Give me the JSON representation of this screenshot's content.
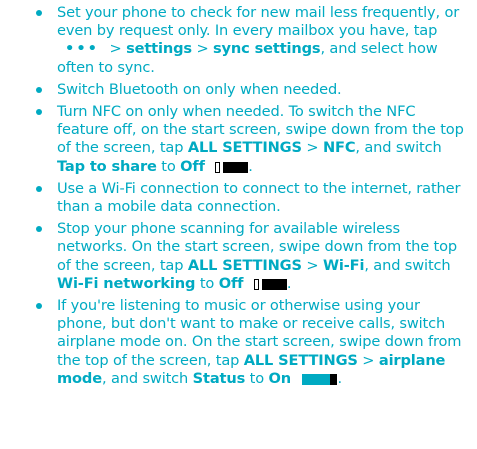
{
  "tips": {
    "t1": {
      "a": "Set your phone to check for new mail less frequently, or even by request only. In every mailbox you have, tap",
      "dots": "•••",
      "sep1": ">",
      "b1": "settings",
      "sep2": ">",
      "b2": "sync settings",
      "c": ", and select how often to sync."
    },
    "t2": {
      "a": "Switch Bluetooth on only when needed."
    },
    "t3": {
      "a": "Turn NFC on only when needed. To switch the NFC feature off, on the start screen, swipe down from the top of the screen, tap",
      "b1": "ALL SETTINGS",
      "sep1": ">",
      "b2": "NFC",
      "c": ", and switch",
      "b3": "Tap to share",
      "d": "to",
      "b4": "Off",
      "e": "."
    },
    "t4": {
      "a": "Use a Wi-Fi connection to connect to the internet, rather than a mobile data connection."
    },
    "t5": {
      "a": "Stop your phone scanning for available wireless networks. On the start screen, swipe down from the top of the screen, tap",
      "b1": "ALL SETTINGS",
      "sep1": ">",
      "b2": "Wi-Fi",
      "c": ", and switch",
      "b3": "Wi-Fi networking",
      "d": "to",
      "b4": "Off",
      "e": "."
    },
    "t6": {
      "a": "If you're listening to music or otherwise using your phone, but don't want to make or receive calls, switch airplane mode on. On the start screen, swipe down from the top of the screen, tap",
      "b1": "ALL SETTINGS",
      "sep1": ">",
      "b2": "airplane mode",
      "c": ", and switch",
      "b3": "Status",
      "d": "to",
      "b4": "On",
      "e": "."
    }
  },
  "icons": {
    "more": "more-dots-icon",
    "toggle_off": "toggle-off-icon",
    "toggle_on": "toggle-on-icon"
  },
  "colors": {
    "text": "#00aac2",
    "toggle_dark": "#000000"
  }
}
